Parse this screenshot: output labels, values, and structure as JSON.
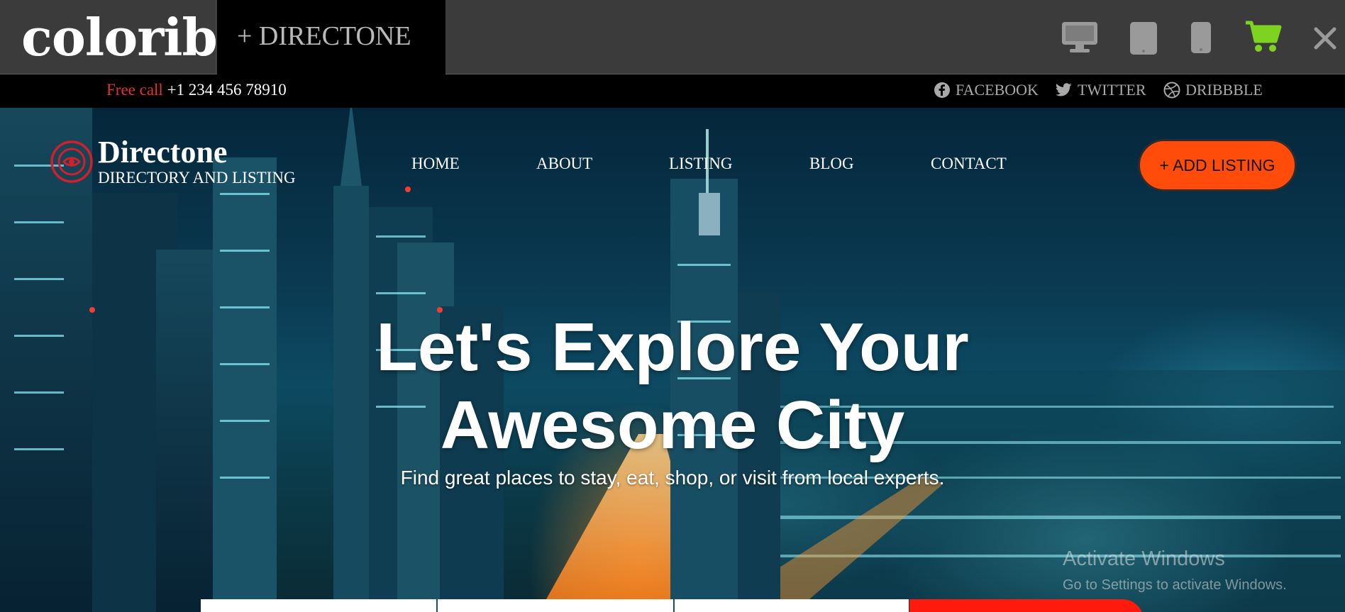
{
  "preview_bar": {
    "brand": "colorib.",
    "product_tab": "+ DIRECTONE",
    "icons": [
      "desktop-icon",
      "tablet-icon",
      "mobile-icon",
      "cart-icon",
      "close-icon"
    ],
    "cart_color": "#7ed321"
  },
  "info_bar": {
    "free_call_label": "Free call",
    "phone": "+1 234 456 78910",
    "social": [
      {
        "icon": "facebook-icon",
        "label": "FACEBOOK"
      },
      {
        "icon": "twitter-icon",
        "label": "TWITTER"
      },
      {
        "icon": "dribbble-icon",
        "label": "DRIBBBLE"
      }
    ]
  },
  "site_header": {
    "logo_name": "Directone",
    "logo_tagline": "DIRECTORY AND LISTING",
    "nav": [
      "HOME",
      "ABOUT",
      "LISTING",
      "BLOG",
      "CONTACT"
    ],
    "cta": "+ ADD LISTING",
    "cta_color": "#ff4c0b"
  },
  "hero": {
    "title_line1": "Let's Explore Your",
    "title_line2": "Awesome City",
    "subtitle": "Find great places to stay, eat, shop, or visit from local experts."
  },
  "os_watermark": {
    "title": "Activate Windows",
    "subtitle": "Go to Settings to activate Windows."
  }
}
